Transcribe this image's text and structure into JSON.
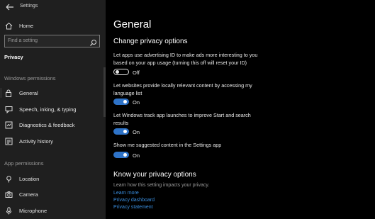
{
  "window": {
    "title": "Settings"
  },
  "sidebar": {
    "home_label": "Home",
    "search_placeholder": "Find a setting",
    "section_title": "Privacy",
    "windows_permissions_header": "Windows permissions",
    "windows_permissions": [
      {
        "label": "General",
        "icon": "lock-icon",
        "selected": true
      },
      {
        "label": "Speech, inking, & typing",
        "icon": "speech-icon"
      },
      {
        "label": "Diagnostics & feedback",
        "icon": "feedback-icon"
      },
      {
        "label": "Activity history",
        "icon": "history-icon"
      }
    ],
    "app_permissions_header": "App permissions",
    "app_permissions": [
      {
        "label": "Location",
        "icon": "location-icon"
      },
      {
        "label": "Camera",
        "icon": "camera-icon"
      },
      {
        "label": "Microphone",
        "icon": "microphone-icon"
      }
    ]
  },
  "main": {
    "title": "General",
    "section_title": "Change privacy options",
    "options": [
      {
        "text": "Let apps use advertising ID to make ads more interesting to you based on your app usage (turning this off will reset your ID)",
        "state_label": "Off",
        "on": false
      },
      {
        "text": "Let websites provide locally relevant content by accessing my language list",
        "state_label": "On",
        "on": true
      },
      {
        "text": "Let Windows track app launches to improve Start and search results",
        "state_label": "On",
        "on": true
      },
      {
        "text": "Show me suggested content in the Settings app",
        "state_label": "On",
        "on": true
      }
    ],
    "know_title": "Know your privacy options",
    "know_subtitle": "Learn how this setting impacts your privacy.",
    "links": [
      "Learn more",
      "Privacy dashboard",
      "Privacy statement"
    ]
  },
  "colors": {
    "accent": "#2e73c8",
    "link": "#3a8fe0",
    "sidebar_bg": "#1f1f1f",
    "main_bg": "#000000"
  }
}
